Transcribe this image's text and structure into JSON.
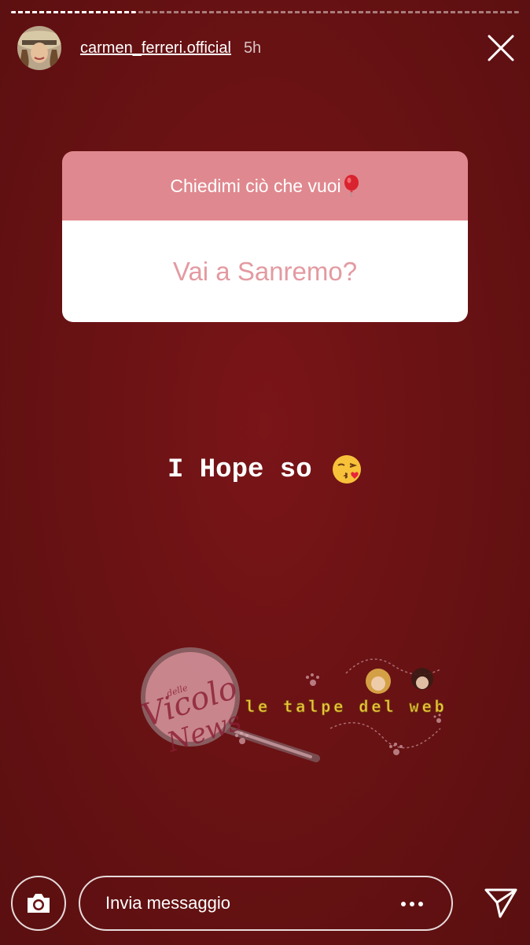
{
  "story": {
    "segments_total": 4,
    "segments_done": 1,
    "username": "carmen_ferreri.official",
    "time_ago": "5h"
  },
  "question_sticker": {
    "prompt": "Chiedimi ciò che vuoi",
    "prompt_emoji": "balloon-icon",
    "question": "Vai a Sanremo?"
  },
  "caption": {
    "text": "I Hope so",
    "emoji": "kissing-face-emoji"
  },
  "watermark": {
    "brand_script": "Vicolo delle News",
    "tagline": "le talpe del web"
  },
  "footer": {
    "message_placeholder": "Invia messaggio"
  },
  "colors": {
    "background": "#6a1214",
    "sticker_header": "#e0888f",
    "question_text": "#e39aa1"
  }
}
